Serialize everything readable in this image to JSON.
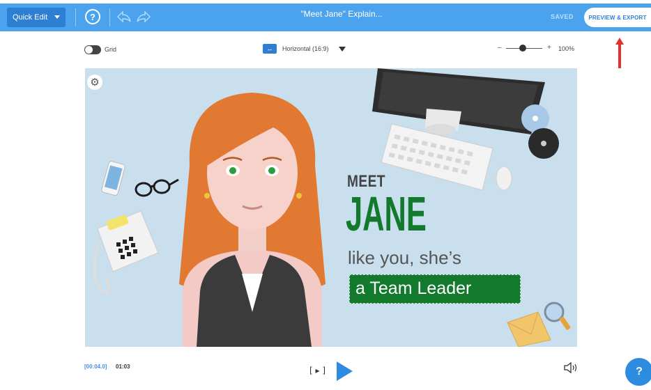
{
  "toolbar": {
    "quick_edit": "Quick Edit",
    "help": "?",
    "title": "\"Meet Jane\" Explain...",
    "saved": "SAVED",
    "preview_export": "PREVIEW & EXPORT"
  },
  "controls": {
    "grid_label": "Grid",
    "orientation": "Horizontal (16:9)",
    "zoom_minus": "–",
    "zoom_plus": "+",
    "zoom_value": "100%"
  },
  "scene": {
    "meet": "MEET",
    "jane": "JANE",
    "like": "like you, she’s",
    "team": "a Team Leader"
  },
  "player": {
    "current_time": "[00:04.0]",
    "total_time": "01:03",
    "frame_step": "[ ▸ ]"
  },
  "help_fab": "?",
  "colors": {
    "accent": "#4aa3ec",
    "brand_green": "#137a2d",
    "canvas_bg": "#c9dfee"
  }
}
